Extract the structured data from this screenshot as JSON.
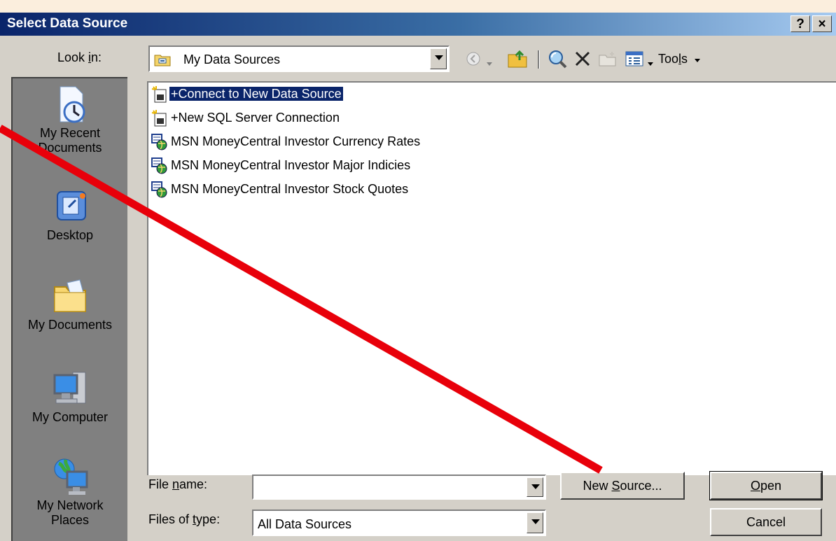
{
  "window": {
    "title": "Select Data Source",
    "help_label": "?",
    "close_label": "×"
  },
  "look_in": {
    "label_before": "Look ",
    "label_accel": "i",
    "label_after": "n:",
    "value": "My Data Sources"
  },
  "toolbar": {
    "tools_before": "Too",
    "tools_accel": "l",
    "tools_after": "s"
  },
  "places": [
    {
      "label_line1": "My Recent",
      "label_line2": "Documents",
      "icon": "recent-documents-icon"
    },
    {
      "label_line1": "Desktop",
      "label_line2": "",
      "icon": "desktop-icon"
    },
    {
      "label_line1": "My Documents",
      "label_line2": "",
      "icon": "my-documents-icon"
    },
    {
      "label_line1": "My Computer",
      "label_line2": "",
      "icon": "my-computer-icon"
    },
    {
      "label_line1": "My Network",
      "label_line2": "Places",
      "icon": "network-places-icon"
    }
  ],
  "files": [
    {
      "name": "+Connect to New Data Source",
      "icon": "new-connection-icon",
      "selected": true
    },
    {
      "name": "+New SQL Server Connection",
      "icon": "new-connection-icon",
      "selected": false
    },
    {
      "name": "MSN MoneyCentral Investor Currency Rates",
      "icon": "web-query-icon",
      "selected": false
    },
    {
      "name": "MSN MoneyCentral Investor Major Indicies",
      "icon": "web-query-icon",
      "selected": false
    },
    {
      "name": "MSN MoneyCentral Investor Stock Quotes",
      "icon": "web-query-icon",
      "selected": false
    }
  ],
  "file_name": {
    "label_before": "File ",
    "label_accel": "n",
    "label_after": "ame:",
    "value": ""
  },
  "files_of_type": {
    "label_before": "Files of ",
    "label_accel": "t",
    "label_after": "ype:",
    "value": "All Data Sources"
  },
  "buttons": {
    "new_source_before": "New ",
    "new_source_accel": "S",
    "new_source_after": "ource...",
    "open_accel": "O",
    "open_after": "pen",
    "cancel": "Cancel"
  },
  "colors": {
    "annotation_arrow": "#e8000a",
    "title_gradient_start": "#0a246a",
    "selection": "#0a246a"
  }
}
